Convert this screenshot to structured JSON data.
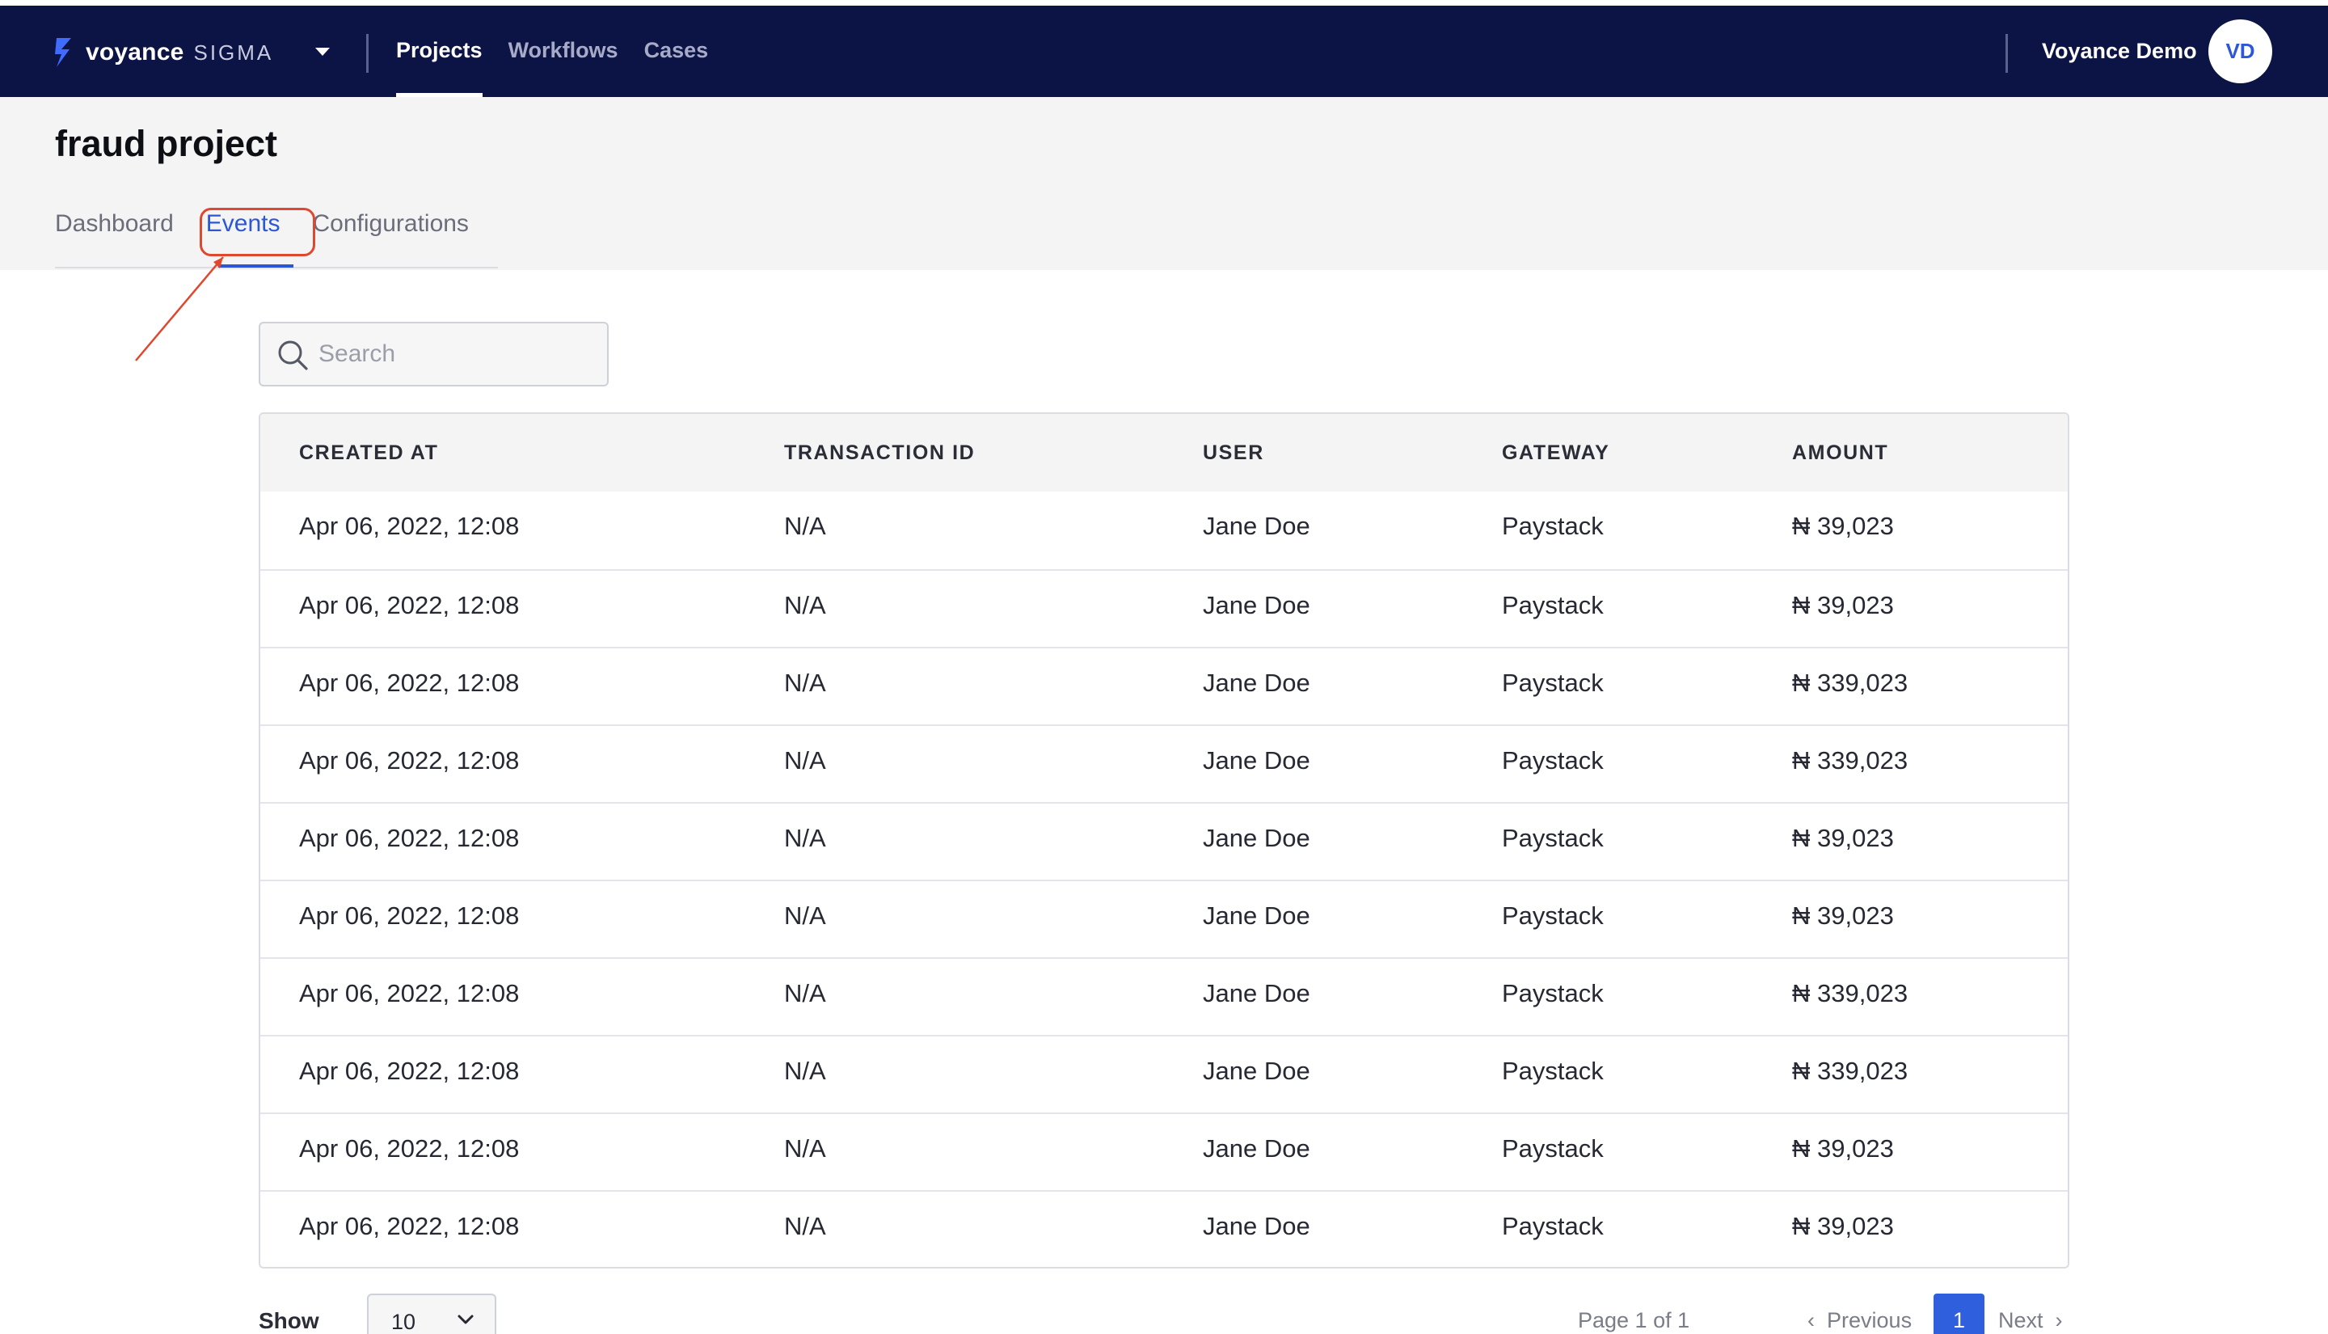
{
  "topbar": {
    "brand_name": "voyance",
    "brand_sub": "SIGMA",
    "nav": [
      {
        "label": "Projects",
        "active": true
      },
      {
        "label": "Workflows",
        "active": false
      },
      {
        "label": "Cases",
        "active": false
      }
    ],
    "user_name": "Voyance Demo",
    "avatar_initials": "VD"
  },
  "project": {
    "title": "fraud project",
    "tabs": [
      {
        "label": "Dashboard",
        "active": false
      },
      {
        "label": "Events",
        "active": true
      },
      {
        "label": "Configurations",
        "active": false
      }
    ]
  },
  "search": {
    "placeholder": "Search",
    "icon": "search-icon"
  },
  "table": {
    "columns": [
      "CREATED AT",
      "TRANSACTION ID",
      "USER",
      "GATEWAY",
      "AMOUNT"
    ],
    "rows": [
      [
        "Apr 06, 2022, 12:08",
        "N/A",
        "Jane Doe",
        "Paystack",
        "₦ 39,023"
      ],
      [
        "Apr 06, 2022, 12:08",
        "N/A",
        "Jane Doe",
        "Paystack",
        "₦ 39,023"
      ],
      [
        "Apr 06, 2022, 12:08",
        "N/A",
        "Jane Doe",
        "Paystack",
        "₦ 339,023"
      ],
      [
        "Apr 06, 2022, 12:08",
        "N/A",
        "Jane Doe",
        "Paystack",
        "₦ 339,023"
      ],
      [
        "Apr 06, 2022, 12:08",
        "N/A",
        "Jane Doe",
        "Paystack",
        "₦ 39,023"
      ],
      [
        "Apr 06, 2022, 12:08",
        "N/A",
        "Jane Doe",
        "Paystack",
        "₦ 39,023"
      ],
      [
        "Apr 06, 2022, 12:08",
        "N/A",
        "Jane Doe",
        "Paystack",
        "₦ 339,023"
      ],
      [
        "Apr 06, 2022, 12:08",
        "N/A",
        "Jane Doe",
        "Paystack",
        "₦ 339,023"
      ],
      [
        "Apr 06, 2022, 12:08",
        "N/A",
        "Jane Doe",
        "Paystack",
        "₦ 39,023"
      ],
      [
        "Apr 06, 2022, 12:08",
        "N/A",
        "Jane Doe",
        "Paystack",
        "₦ 39,023"
      ]
    ]
  },
  "pagination": {
    "show_label": "Show",
    "page_size": "10",
    "page_info": "Page 1 of 1",
    "previous_label": "Previous",
    "current_page": "1",
    "next_label": "Next"
  },
  "colors": {
    "topbar_bg": "#0c1445",
    "accent": "#2b57d6",
    "annotation": "#e0472f"
  }
}
